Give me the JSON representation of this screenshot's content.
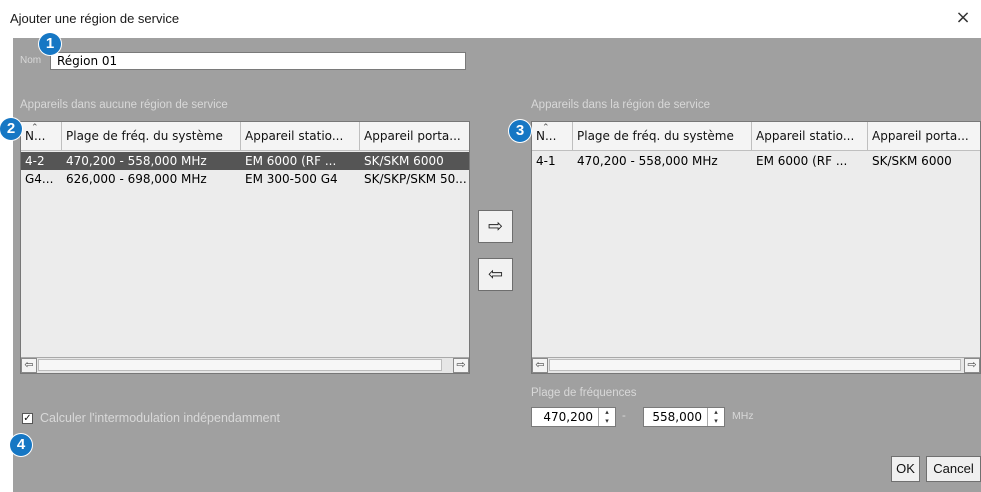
{
  "window": {
    "title": "Ajouter une région de service",
    "close_glyph": "×"
  },
  "name": {
    "label": "Nom",
    "value": "Région 01"
  },
  "left_table": {
    "caption": "Appareils dans aucune région de service",
    "columns": [
      "N...",
      "Plage de fréq. du système",
      "Appareil statio...",
      "Appareil porta..."
    ],
    "rows": [
      {
        "cells": [
          "4-2",
          "470,200 - 558,000 MHz",
          "EM 6000 (RF ...",
          "SK/SKM 6000"
        ],
        "selected": true
      },
      {
        "cells": [
          "G4...",
          "626,000 - 698,000 MHz",
          "EM 300-500 G4",
          "SK/SKP/SKM 50..."
        ],
        "selected": false
      }
    ]
  },
  "right_table": {
    "caption": "Appareils dans la région de service",
    "columns": [
      "N...",
      "Plage de fréq. du système",
      "Appareil statio...",
      "Appareil porta..."
    ],
    "rows": [
      {
        "cells": [
          "4-1",
          "470,200 - 558,000 MHz",
          "EM 6000 (RF ...",
          "SK/SKM 6000"
        ],
        "selected": false
      }
    ]
  },
  "transfer": {
    "add_glyph": "⇨",
    "remove_glyph": "⇦"
  },
  "scroll": {
    "left_glyph": "⇦",
    "right_glyph": "⇨"
  },
  "options": {
    "intermod_label": "Calculer l'intermodulation indépendamment",
    "intermod_checked": true,
    "check_glyph": "✓"
  },
  "frequency": {
    "label": "Plage de fréquences",
    "min": "470,200",
    "separator": "-",
    "max": "558,000",
    "unit": "MHz",
    "up_glyph": "▴",
    "down_glyph": "▾"
  },
  "buttons": {
    "ok": "OK",
    "cancel": "Cancel"
  },
  "callouts": [
    "1",
    "2",
    "3",
    "4"
  ],
  "colors": {
    "panel_bg": "#a0a0a0",
    "callout": "#1677c4",
    "selected_row": "#555555"
  }
}
